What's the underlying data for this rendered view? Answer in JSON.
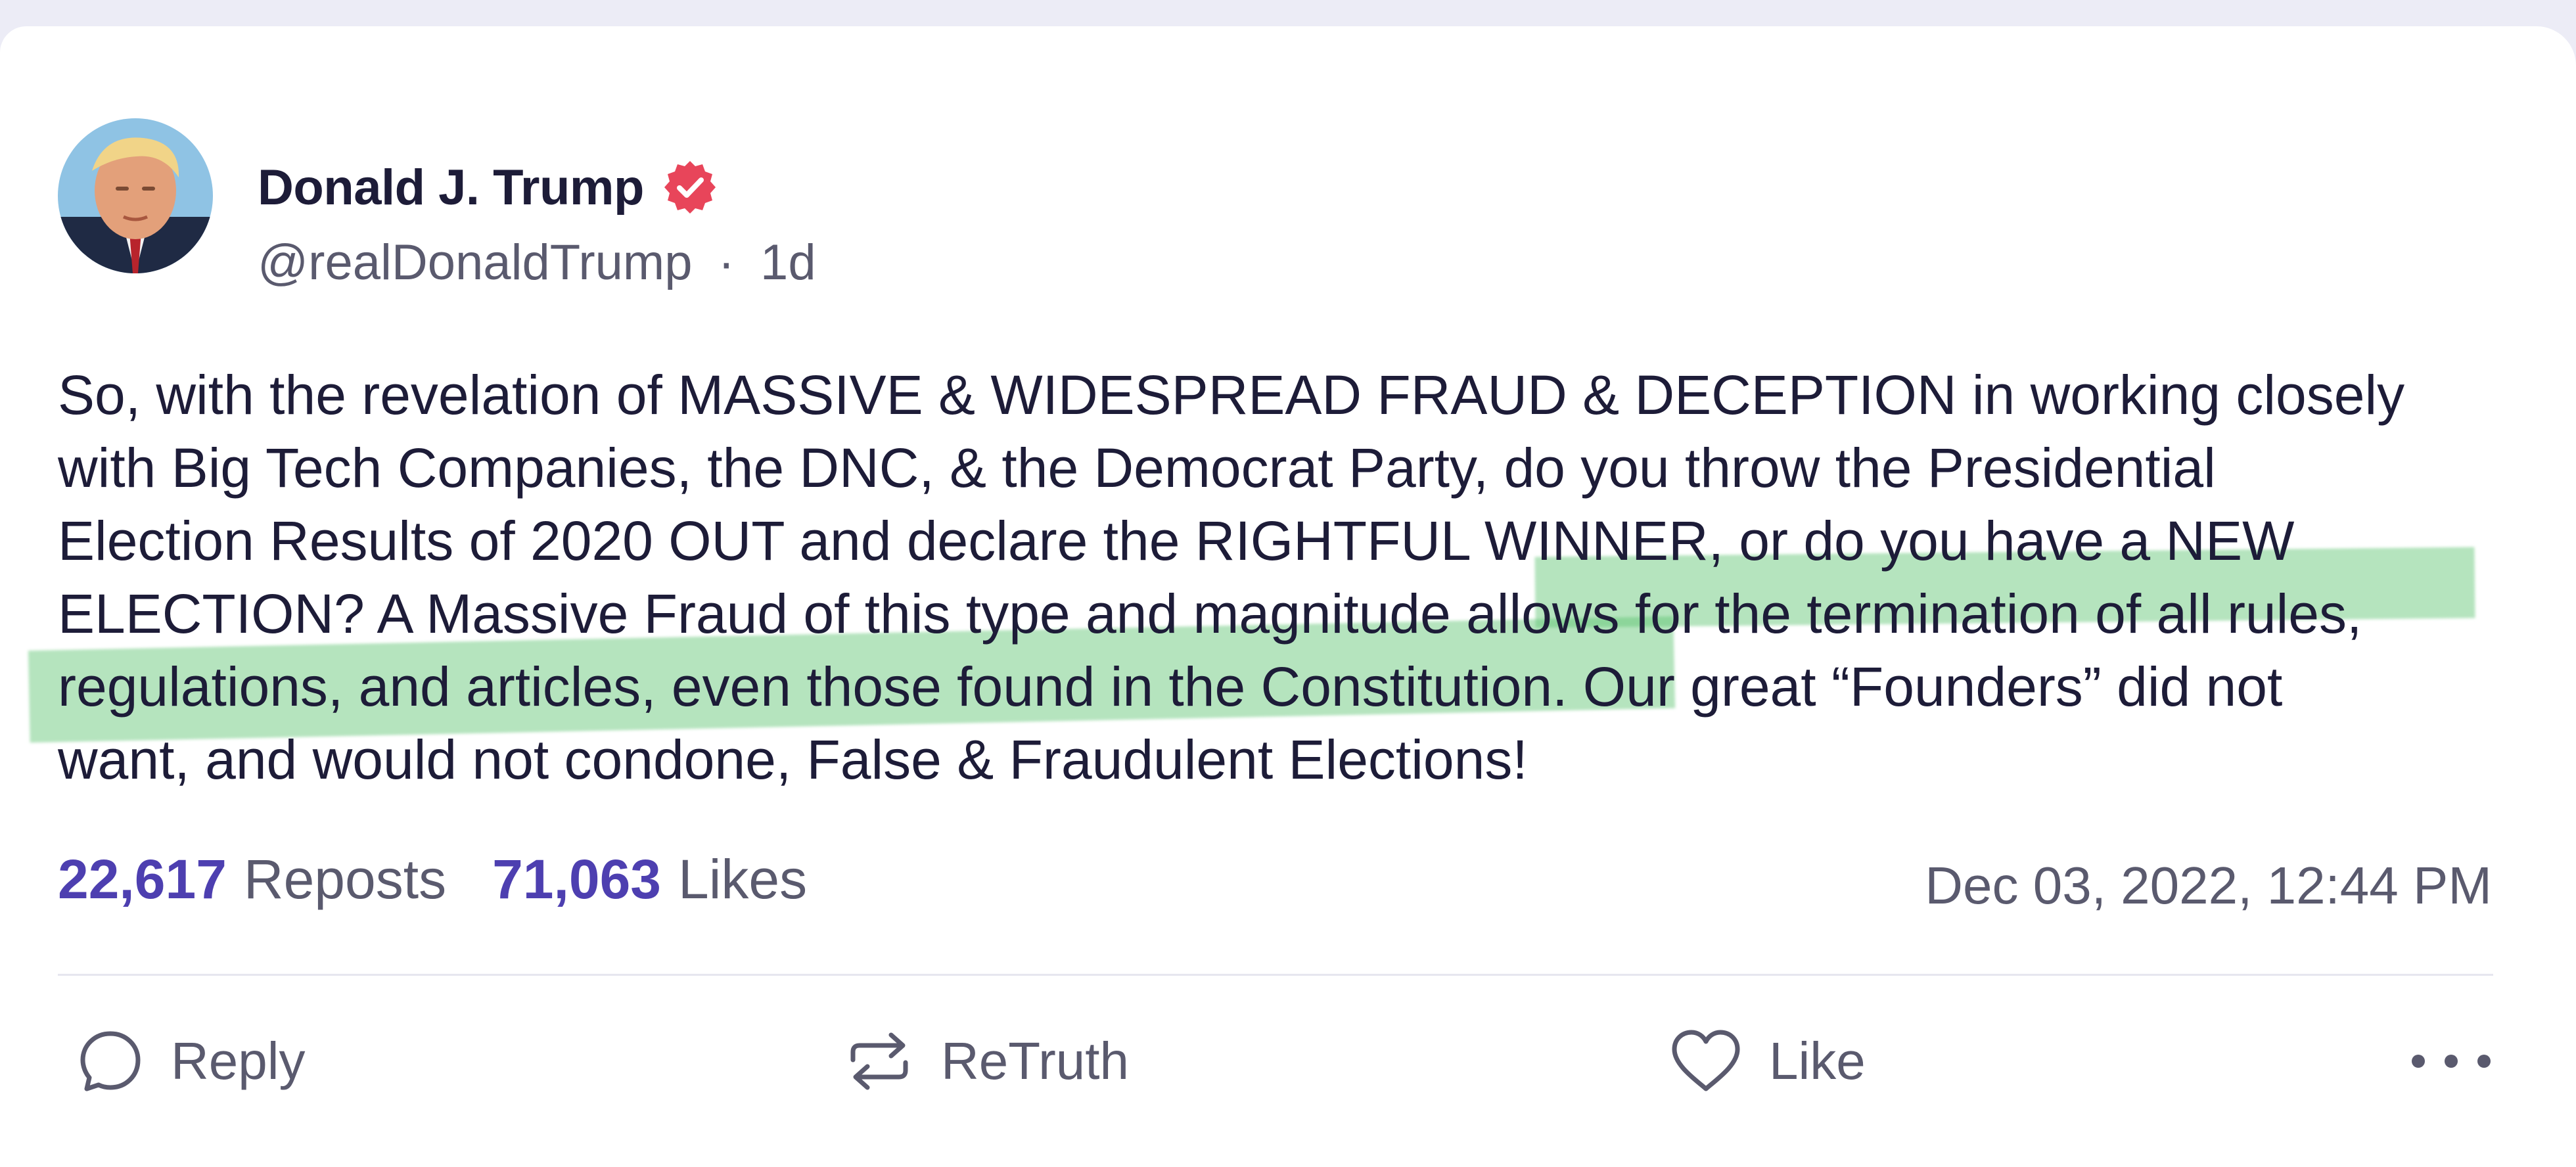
{
  "author": {
    "display_name": "Donald J. Trump",
    "handle": "@realDonaldTrump",
    "separator": "·",
    "relative_time": "1d",
    "verified": true
  },
  "post": {
    "lines": [
      "So, with the revelation of MASSIVE & WIDESPREAD FRAUD & DECEPTION in working closely",
      "with Big Tech Companies, the DNC, & the Democrat Party, do you throw the Presidential",
      "Election Results of 2020 OUT and declare the RIGHTFUL WINNER, or do you have a NEW",
      "ELECTION? A Massive Fraud of this type and magnitude allows for the termination of all rules,",
      "regulations, and articles, even those found in the Constitution. Our great “Founders” did not",
      "want, and would not condone, False & Fraudulent Elections!"
    ],
    "highlighted_text": "allows for the termination of all rules, regulations, and articles, even those found in the Constitution."
  },
  "stats": {
    "reposts_count": "22,617",
    "reposts_label": "Reposts",
    "likes_count": "71,063",
    "likes_label": "Likes",
    "timestamp": "Dec 03, 2022, 12:44 PM"
  },
  "actions": {
    "reply_label": "Reply",
    "retruth_label": "ReTruth",
    "like_label": "Like"
  },
  "colors": {
    "accent": "#4d3fb0",
    "verified_badge": "#e8455a",
    "highlight": "#5cc46e",
    "text": "#1d1c38",
    "muted": "#5a5a6e"
  },
  "icons": {
    "reply": "speech-bubble-icon",
    "retruth": "repost-arrows-icon",
    "like": "heart-icon",
    "more": "more-dots-icon",
    "verified": "verified-badge-icon"
  }
}
